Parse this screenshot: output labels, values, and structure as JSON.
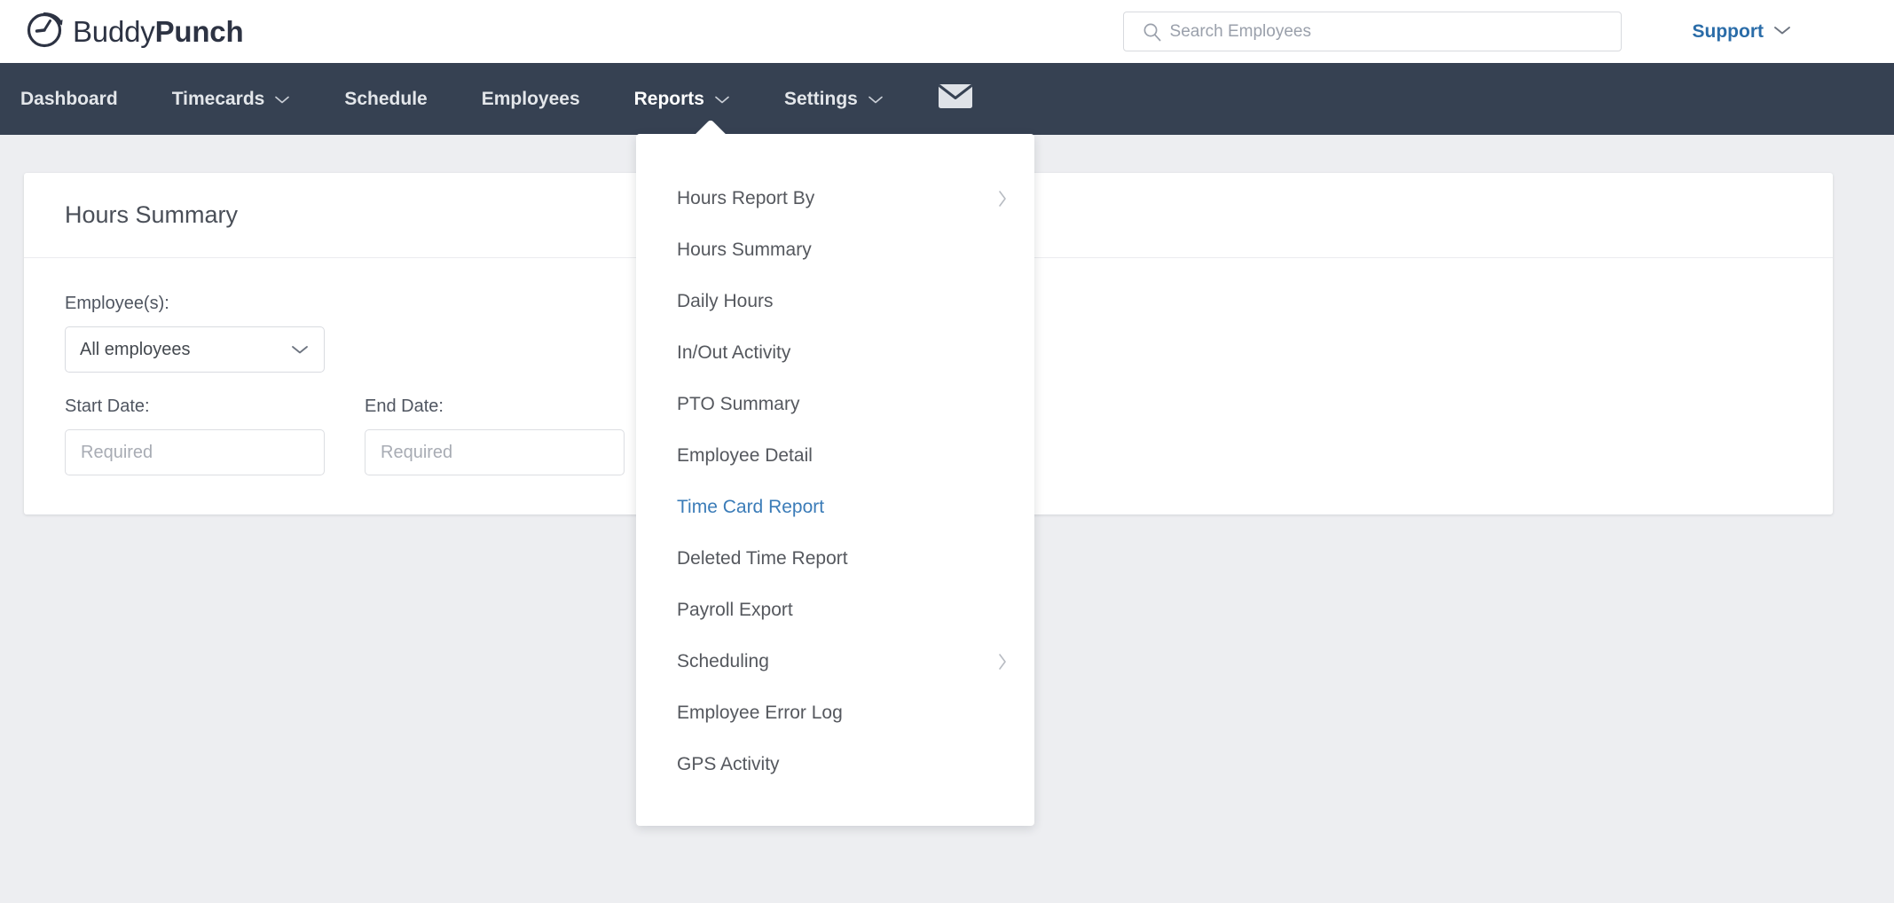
{
  "brand": {
    "icon": "clock-refresh-icon",
    "name_light": "Buddy",
    "name_bold": "Punch"
  },
  "search": {
    "icon": "search-icon",
    "placeholder": "Search Employees",
    "value": ""
  },
  "support": {
    "label": "Support",
    "icon": "chevron-down-icon",
    "color": "#2a6ca8"
  },
  "nav": {
    "background": "#364152",
    "items": [
      {
        "label": "Dashboard",
        "has_chevron": false,
        "active": false
      },
      {
        "label": "Timecards",
        "has_chevron": true,
        "active": false
      },
      {
        "label": "Schedule",
        "has_chevron": false,
        "active": false
      },
      {
        "label": "Employees",
        "has_chevron": false,
        "active": false
      },
      {
        "label": "Reports",
        "has_chevron": true,
        "active": true
      },
      {
        "label": "Settings",
        "has_chevron": true,
        "active": false
      }
    ],
    "mail_icon": "envelope-icon"
  },
  "card": {
    "title": "Hours Summary",
    "employee_label": "Employee(s):",
    "employee_value": "All employees",
    "employee_chevron": "chevron-down-icon",
    "start_date_label": "Start Date:",
    "start_date_placeholder": "Required",
    "start_date_value": "",
    "end_date_label": "End Date:",
    "end_date_placeholder": "Required",
    "end_date_value": ""
  },
  "reports_menu": {
    "highlight_color": "#3b7cb8",
    "items": [
      {
        "label": "Hours Report By",
        "has_submenu": true,
        "highlighted": false
      },
      {
        "label": "Hours Summary",
        "has_submenu": false,
        "highlighted": false
      },
      {
        "label": "Daily Hours",
        "has_submenu": false,
        "highlighted": false
      },
      {
        "label": "In/Out Activity",
        "has_submenu": false,
        "highlighted": false
      },
      {
        "label": "PTO Summary",
        "has_submenu": false,
        "highlighted": false
      },
      {
        "label": "Employee Detail",
        "has_submenu": false,
        "highlighted": false
      },
      {
        "label": "Time Card Report",
        "has_submenu": false,
        "highlighted": true
      },
      {
        "label": "Deleted Time Report",
        "has_submenu": false,
        "highlighted": false
      },
      {
        "label": "Payroll Export",
        "has_submenu": false,
        "highlighted": false
      },
      {
        "label": "Scheduling",
        "has_submenu": true,
        "highlighted": false
      },
      {
        "label": "Employee Error Log",
        "has_submenu": false,
        "highlighted": false
      },
      {
        "label": "GPS Activity",
        "has_submenu": false,
        "highlighted": false
      }
    ]
  }
}
